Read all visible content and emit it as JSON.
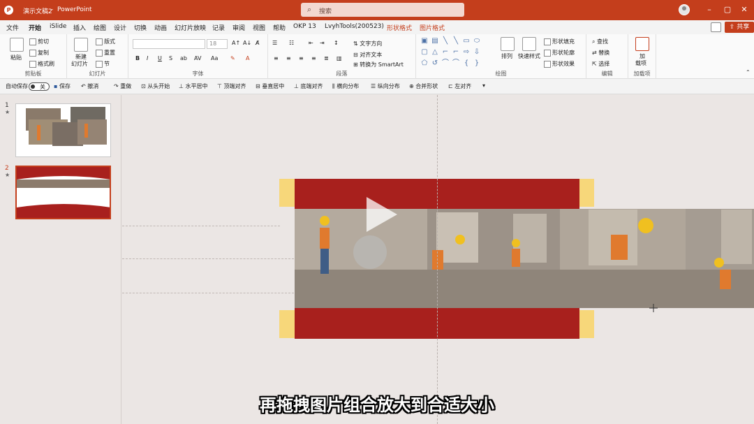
{
  "titlebar": {
    "doc_name": "演示文稿2",
    "separator": "-",
    "app_name": "PowerPoint",
    "search_placeholder": "搜索"
  },
  "tabs": [
    "文件",
    "开始",
    "iSlide",
    "插入",
    "绘图",
    "设计",
    "切换",
    "动画",
    "幻灯片放映",
    "记录",
    "审阅",
    "视图",
    "帮助",
    "OKP 13",
    "LvyhTools(200523)",
    "形状格式",
    "图片格式"
  ],
  "active_tab": "开始",
  "share_label": "共享",
  "ribbon": {
    "clipboard": {
      "paste": "粘贴",
      "cut": "剪切",
      "copy": "复制",
      "format_painter": "格式刷",
      "label": "剪贴板"
    },
    "slides": {
      "new_slide": "新建",
      "new_slide2": "幻灯片",
      "layout": "版式",
      "reset": "重置",
      "section": "节",
      "label": "幻灯片"
    },
    "font": {
      "font_size": "18",
      "bold": "B",
      "italic": "I",
      "underline": "U",
      "strike": "S",
      "label": "字体"
    },
    "paragraph": {
      "text_direction": "文字方向",
      "align_text": "对齐文本",
      "smartart": "转换为 SmartArt",
      "label": "段落"
    },
    "drawing": {
      "arrange": "排列",
      "quick_styles": "快速样式",
      "shape_fill": "形状填充",
      "shape_outline": "形状轮廓",
      "shape_effects": "形状效果",
      "label": "绘图"
    },
    "editing": {
      "find": "查找",
      "replace": "替换",
      "select": "选择",
      "label": "编辑"
    },
    "addins": {
      "addins": "加",
      "addins2": "载项",
      "label": "加载项"
    }
  },
  "qat": {
    "autosave": "自动保存",
    "autosave_state": "关",
    "items": [
      "保存",
      "撤消",
      "重做",
      "从头开始",
      "水平居中",
      "顶端对齐",
      "垂直居中",
      "底端对齐",
      "横向分布",
      "纵向分布",
      "合并形状",
      "左对齐"
    ]
  },
  "slides": [
    {
      "num": "1",
      "mark": "★"
    },
    {
      "num": "2",
      "mark": "★"
    }
  ],
  "subtitle": "再拖拽图片组合放大到合适大小",
  "colors": {
    "accent": "#c43e1c",
    "slide_red": "#a8201d",
    "slide_yellow": "#f7d77a"
  }
}
